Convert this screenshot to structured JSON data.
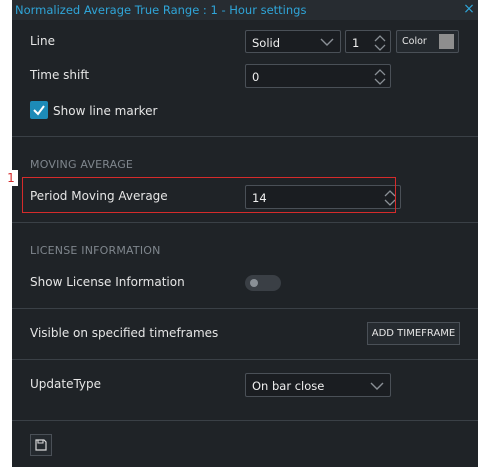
{
  "window": {
    "title": "Normalized Average True Range : 1 - Hour settings",
    "close_glyph": "×"
  },
  "line": {
    "label": "Line",
    "style_value": "Solid",
    "width_value": "1",
    "color_label": "Color",
    "color_swatch": "#8e8e8e"
  },
  "time_shift": {
    "label": "Time shift",
    "value": "0"
  },
  "show_line_marker": {
    "label": "Show line marker",
    "checked": true
  },
  "moving_average": {
    "section_title": "MOVING AVERAGE",
    "period_label": "Period Moving Average",
    "period_value": "14",
    "marker_number": "1"
  },
  "license": {
    "section_title": "LICENSE INFORMATION",
    "show_label": "Show License Information",
    "enabled": false
  },
  "timeframes": {
    "label": "Visible on specified timeframes",
    "add_button": "ADD TIMEFRAME"
  },
  "update_type": {
    "label": "UpdateType",
    "value": "On bar close"
  },
  "colors": {
    "panel": "#1f2327",
    "accent": "#2fa5d8",
    "highlight": "#d52b2b"
  }
}
